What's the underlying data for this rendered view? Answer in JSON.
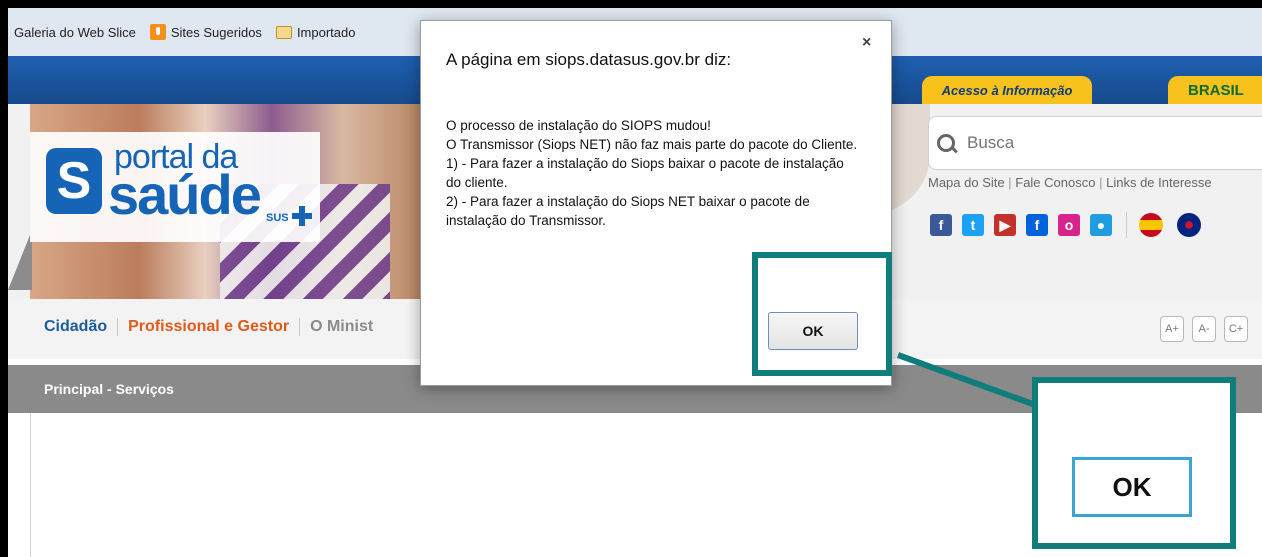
{
  "bookmarks": [
    {
      "label": "Galeria do Web Slice",
      "icon": "none"
    },
    {
      "label": "Sites Sugeridos",
      "icon": "suggested-sites-icon"
    },
    {
      "label": "Importado",
      "icon": "folder-icon"
    }
  ],
  "header": {
    "acesso_label": "Acesso à Informação",
    "brasil_label": "BRASIL"
  },
  "logo": {
    "portal": "portal da",
    "saude": "saúde",
    "sus": "SUS",
    "s": "S"
  },
  "search": {
    "placeholder": "Busca"
  },
  "toplinks": {
    "map": "Mapa do Site",
    "contact": "Fale Conosco",
    "links": "Links de Interesse",
    "sep": "|"
  },
  "socials": [
    {
      "name": "facebook-icon",
      "glyph": "f",
      "color": "#3b5998"
    },
    {
      "name": "twitter-icon",
      "glyph": "t",
      "color": "#1da1f2"
    },
    {
      "name": "youtube-icon",
      "glyph": "▶",
      "color": "#c4302b"
    },
    {
      "name": "flickr-icon",
      "glyph": "f",
      "color": "#0063dc"
    },
    {
      "name": "orkut-icon",
      "glyph": "o",
      "color": "#d6248a"
    },
    {
      "name": "chat-icon",
      "glyph": "●",
      "color": "#1f9de0"
    }
  ],
  "nav": {
    "items": [
      "Cidadão",
      "Profissional e Gestor",
      "O Minist"
    ]
  },
  "fontbtns": [
    "A+",
    "A-",
    "C+"
  ],
  "breadcrumb": "Principal - Serviços",
  "dialog": {
    "title": "A página em siops.datasus.gov.br diz:",
    "close": "×",
    "lines": [
      "O processo de instalação do SIOPS mudou!",
      "O Transmissor (Siops NET) não faz mais parte do pacote do Cliente.",
      "1) - Para fazer a instalação do Siops baixar o pacote de instalação do cliente.",
      "2) - Para fazer a instalação do Siops NET baixar o pacote de instalação do Transmissor."
    ],
    "ok_label": "OK"
  },
  "callout": {
    "ok_label": "OK",
    "color": "#0e7d7b"
  }
}
